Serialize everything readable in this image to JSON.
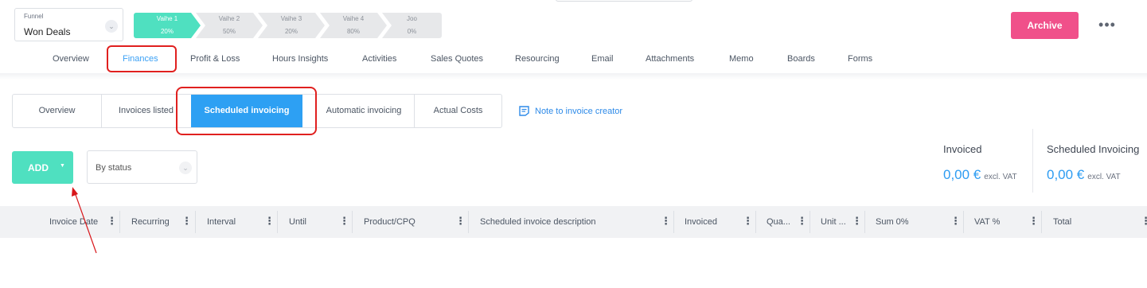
{
  "funnel": {
    "label": "Funnel",
    "value": "Won Deals"
  },
  "stages": [
    {
      "name": "Vaihe 1",
      "percent": "20%",
      "active": true
    },
    {
      "name": "Vaihe 2",
      "percent": "50%",
      "active": false
    },
    {
      "name": "Vaihe 3",
      "percent": "20%",
      "active": false
    },
    {
      "name": "Vaihe 4",
      "percent": "80%",
      "active": false
    },
    {
      "name": "Joo",
      "percent": "0%",
      "active": false
    }
  ],
  "header": {
    "archive_label": "Archive",
    "more_label": "•••"
  },
  "main_tabs": [
    "Overview",
    "Finances",
    "Profit & Loss",
    "Hours Insights",
    "Activities",
    "Sales Quotes",
    "Resourcing",
    "Email",
    "Attachments",
    "Memo",
    "Boards",
    "Forms"
  ],
  "main_tab_active": "Finances",
  "sub_tabs": [
    "Overview",
    "Invoices listed",
    "Scheduled invoicing",
    "Automatic invoicing",
    "Actual Costs"
  ],
  "sub_tab_active": "Scheduled invoicing",
  "note_link": "Note to invoice creator",
  "toolbar": {
    "add_label": "ADD",
    "add_caret": "▼",
    "status_filter": "By status"
  },
  "summary": {
    "invoiced": {
      "label": "Invoiced",
      "amount": "0,00 €",
      "suffix": "excl. VAT"
    },
    "scheduled": {
      "label": "Scheduled Invoicing",
      "amount": "0,00 €",
      "suffix": "excl. VAT"
    }
  },
  "table": {
    "columns": [
      "Invoice Date",
      "Recurring",
      "Interval",
      "Until",
      "Product/CPQ",
      "Scheduled invoice description",
      "Invoiced",
      "Qua...",
      "Unit ...",
      "Sum 0%",
      "VAT %",
      "Total"
    ],
    "menu_glyph": "⋮"
  },
  "colors": {
    "accent_teal": "#4fe0c0",
    "accent_blue": "#2da0f3",
    "archive_pink": "#f0508a",
    "highlight_red": "#e0201f"
  },
  "icons": {
    "note": "note-icon",
    "chevron": "chevron-down-icon",
    "more": "more-dots-icon"
  }
}
